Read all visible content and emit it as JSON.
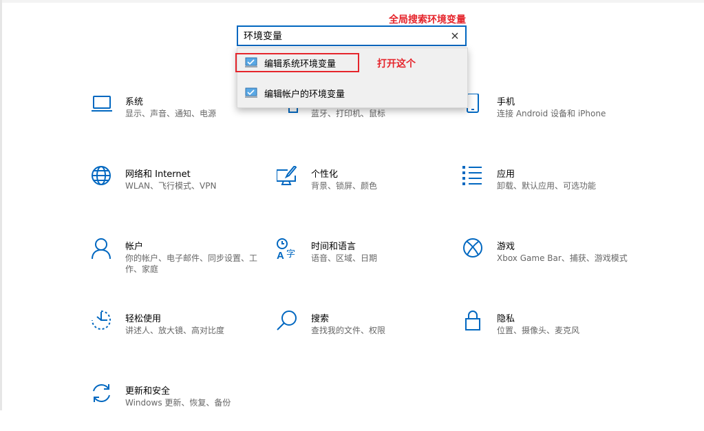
{
  "search": {
    "value": "环境变量",
    "placeholder": ""
  },
  "search_results": [
    {
      "label": "编辑系统环境变量",
      "icon": "control-panel-icon"
    },
    {
      "label": "编辑帐户的环境变量",
      "icon": "control-panel-icon"
    }
  ],
  "annotations": {
    "global_search": "全局搜索环境变量",
    "open_this": "打开这个"
  },
  "accent_color": "#0067c0",
  "annotation_color": "#e5242b",
  "categories": [
    {
      "title": "系统",
      "desc": "显示、声音、通知、电源",
      "icon": "laptop-icon"
    },
    {
      "title": "",
      "desc": "蓝牙、打印机、鼠标",
      "icon": "devices-icon"
    },
    {
      "title": "手机",
      "desc": "连接 Android 设备和 iPhone",
      "icon": "phone-icon"
    },
    {
      "title": "网络和 Internet",
      "desc": "WLAN、飞行模式、VPN",
      "icon": "globe-icon"
    },
    {
      "title": "个性化",
      "desc": "背景、锁屏、颜色",
      "icon": "personalization-icon"
    },
    {
      "title": "应用",
      "desc": "卸载、默认应用、可选功能",
      "icon": "apps-list-icon"
    },
    {
      "title": "帐户",
      "desc": "你的帐户、电子邮件、同步设置、工作、家庭",
      "icon": "person-icon"
    },
    {
      "title": "时间和语言",
      "desc": "语音、区域、日期",
      "icon": "time-language-icon"
    },
    {
      "title": "游戏",
      "desc": "Xbox Game Bar、捕获、游戏模式",
      "icon": "xbox-icon"
    },
    {
      "title": "轻松使用",
      "desc": "讲述人、放大镜、高对比度",
      "icon": "ease-of-access-icon"
    },
    {
      "title": "搜索",
      "desc": "查找我的文件、权限",
      "icon": "search-icon"
    },
    {
      "title": "隐私",
      "desc": "位置、摄像头、麦克风",
      "icon": "lock-icon"
    },
    {
      "title": "更新和安全",
      "desc": "Windows 更新、恢复、备份",
      "icon": "sync-icon"
    }
  ]
}
